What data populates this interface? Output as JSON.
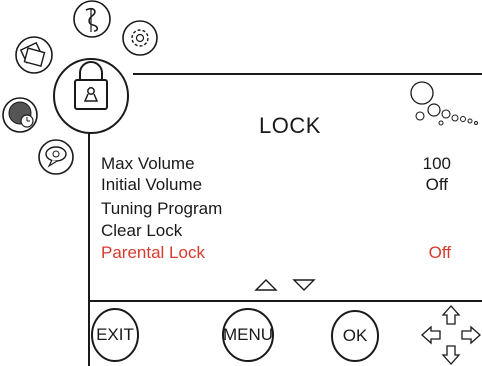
{
  "screen": {
    "title": "LOCK",
    "accent_color": "#d83a2e",
    "text_color": "#1a1a1a"
  },
  "menu": {
    "items": [
      {
        "label": "Max Volume",
        "value": "100",
        "selected": false
      },
      {
        "label": "Initial Volume",
        "value": "Off",
        "selected": false
      },
      {
        "label": "Tuning Program",
        "value": "",
        "selected": false
      },
      {
        "label": "Clear Lock",
        "value": "",
        "selected": false
      },
      {
        "label": "Parental Lock",
        "value": "Off",
        "selected": true
      }
    ]
  },
  "scroll": {
    "up_icon": "triangle-up-icon",
    "down_icon": "triangle-down-icon"
  },
  "buttons": {
    "exit_label": "EXIT",
    "menu_label": "MENU",
    "ok_label": "OK",
    "dpad_icon": "four-way-arrows-icon"
  },
  "category_icons": [
    "music-note-icon",
    "gear-icon",
    "picture-icon",
    "lock-icon",
    "clock-icon",
    "speech-bubble-icon"
  ],
  "decoration_icon": "bubbles-icon"
}
